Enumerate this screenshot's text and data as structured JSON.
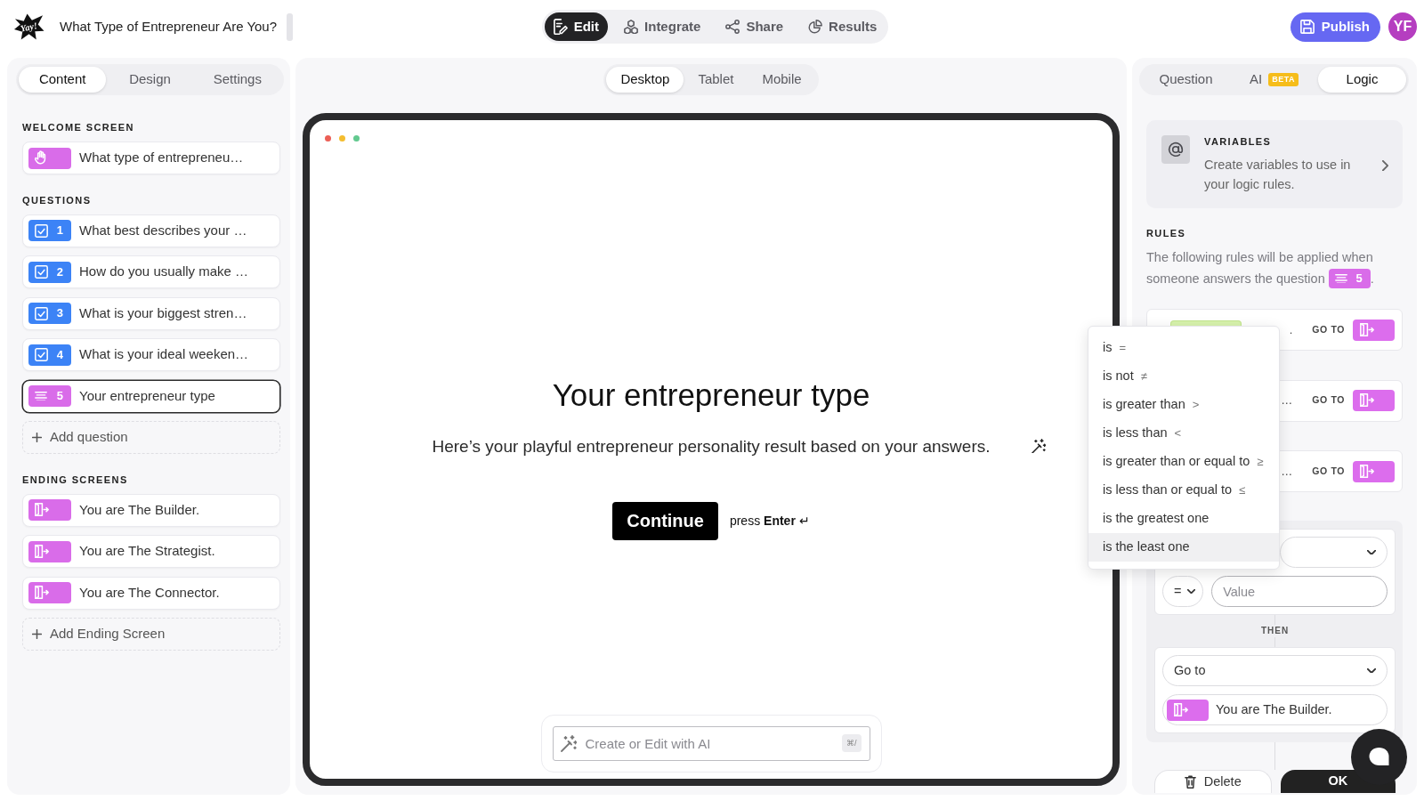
{
  "header": {
    "logo_text": "Yay!",
    "title": "What Type of Entrepreneur Are You?",
    "modes": [
      {
        "kind": "edit",
        "label": "Edit",
        "selected": true
      },
      {
        "kind": "integrate",
        "label": "Integrate",
        "selected": false
      },
      {
        "kind": "share",
        "label": "Share",
        "selected": false
      },
      {
        "kind": "results",
        "label": "Results",
        "selected": false
      }
    ],
    "publish_button": "Publish",
    "avatar_initials": "YF"
  },
  "content_panel": {
    "tabs": [
      {
        "label": "Content",
        "selected": true
      },
      {
        "label": "Design",
        "selected": false
      },
      {
        "label": "Settings",
        "selected": false
      }
    ],
    "sections": [
      {
        "heading": "WELCOME SCREEN",
        "items": [
          {
            "kind": "welcome",
            "title": "What type of entrepreneu…",
            "selected": false
          }
        ]
      },
      {
        "heading": "QUESTIONS",
        "items": [
          {
            "kind": "multiple_choice",
            "number": "1",
            "title": "What best describes your …",
            "selected": false
          },
          {
            "kind": "multiple_choice",
            "number": "2",
            "title": "How do you usually make …",
            "selected": false
          },
          {
            "kind": "multiple_choice",
            "number": "3",
            "title": "What is your biggest stren…",
            "selected": false
          },
          {
            "kind": "multiple_choice",
            "number": "4",
            "title": "What is your ideal weeken…",
            "selected": false
          },
          {
            "kind": "statement",
            "number": "5",
            "title": "Your entrepreneur type",
            "selected": true
          }
        ],
        "add_button": "Add question"
      },
      {
        "heading": "ENDING SCREENS",
        "items": [
          {
            "kind": "ending",
            "title": "You are The Builder.",
            "selected": false
          },
          {
            "kind": "ending",
            "title": "You are The Strategist.",
            "selected": false
          },
          {
            "kind": "ending",
            "title": "You are The Connector.",
            "selected": false
          }
        ],
        "add_button": "Add Ending Screen"
      }
    ]
  },
  "preview": {
    "devices": [
      {
        "label": "Desktop",
        "selected": true
      },
      {
        "label": "Tablet",
        "selected": false
      },
      {
        "label": "Mobile",
        "selected": false
      }
    ],
    "title": "Your entrepreneur type",
    "description": "Here’s your playful entrepreneur personality result based on your answers.",
    "button": "Continue",
    "key_hint": "press **Enter** ↵",
    "ai_prompt": {
      "placeholder": "Create or Edit with AI",
      "shortcut": "⌘/"
    }
  },
  "logic_panel": {
    "tabs": [
      {
        "label": "Question",
        "selected": false
      },
      {
        "label": "AI",
        "badge": "BETA",
        "selected": false
      },
      {
        "label": "Logic",
        "selected": true
      }
    ],
    "variables": {
      "heading": "VARIABLES",
      "text": "Create variables to use in your logic rules."
    },
    "rules_heading": "RULES",
    "rules_intro_lines": [
      "The following rules will be applied when",
      "someone answers the question"
    ],
    "question_badge": {
      "kind": "statement",
      "number": "5"
    },
    "rules_intro_end": ".",
    "rules": [
      {
        "condition": ".",
        "action": "GO TO",
        "tag": true
      },
      {
        "condition": "…",
        "action": "GO TO"
      },
      {
        "condition": "…",
        "action": "GO TO"
      }
    ],
    "editor": {
      "operator": "=",
      "value_field": {
        "placeholder": "Value"
      },
      "then_label": "THEN",
      "action": "Go to",
      "target": "You are The Builder."
    },
    "delete_button": "Delete",
    "ok_button": "OK"
  },
  "operator_menu": [
    {
      "label": "is",
      "symbol": "=",
      "selected": false
    },
    {
      "label": "is not",
      "symbol": "≠",
      "selected": false
    },
    {
      "label": "is greater than",
      "symbol": ">",
      "selected": false
    },
    {
      "label": "is less than",
      "symbol": "<",
      "selected": false
    },
    {
      "label": "is greater than or equal to",
      "symbol": "≥",
      "selected": false
    },
    {
      "label": "is less than or equal to",
      "symbol": "≤",
      "selected": false
    },
    {
      "label": "is the greatest one",
      "selected": false
    },
    {
      "label": "is the least one",
      "selected": true
    }
  ]
}
